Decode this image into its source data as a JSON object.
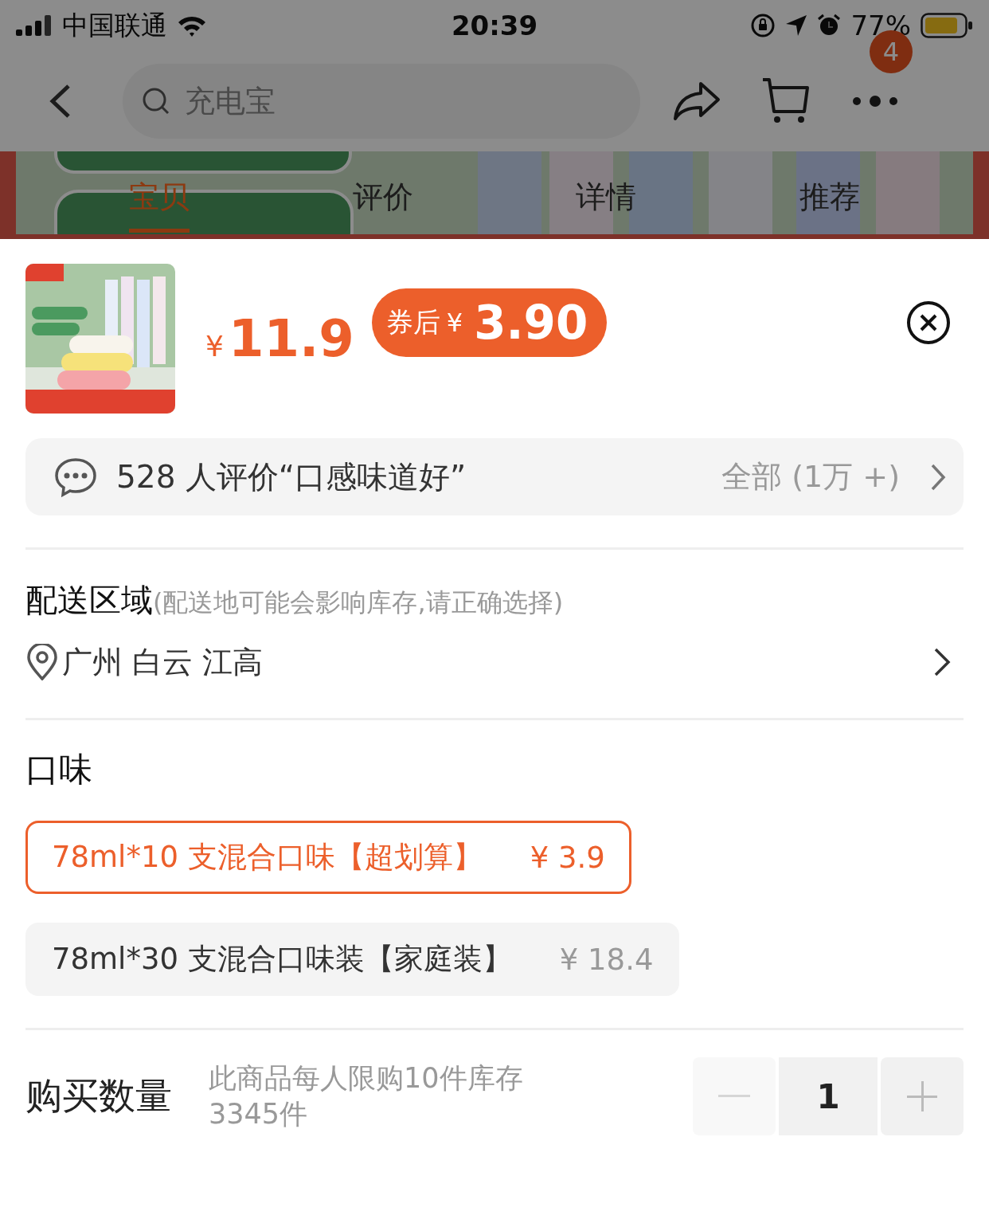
{
  "status_bar": {
    "carrier": "中国联通",
    "time": "20:39",
    "battery": "77%"
  },
  "nav": {
    "search": {
      "placeholder": "充电宝"
    },
    "cart_badge": "4"
  },
  "tabs": [
    {
      "label": "宝贝",
      "selected": true
    },
    {
      "label": "评价",
      "selected": false
    },
    {
      "label": "详情",
      "selected": false
    },
    {
      "label": "推荐",
      "selected": false
    }
  ],
  "product": {
    "price_symbol": "¥",
    "price": "11.9",
    "coupon_label": "券后",
    "coupon_symbol": "¥",
    "coupon_price": "3.90"
  },
  "review": {
    "summary": "528 人评价“口感味道好”",
    "all_link": "全部 (1万 +)"
  },
  "delivery": {
    "title": "配送区域",
    "note": "(配送地可能会影响库存,请正确选择)",
    "location": "广州 白云 江高"
  },
  "flavor": {
    "title": "口味",
    "options": [
      {
        "label": "78ml*10 支混合口味【超划算】",
        "price": "¥ 3.9",
        "selected": true
      },
      {
        "label": "78ml*30 支混合口味装【家庭装】",
        "price": "¥ 18.4",
        "selected": false
      }
    ]
  },
  "quantity": {
    "title": "购买数量",
    "note": "此商品每人限购10件库存3345件",
    "value": "1",
    "decrement_disabled": true
  }
}
